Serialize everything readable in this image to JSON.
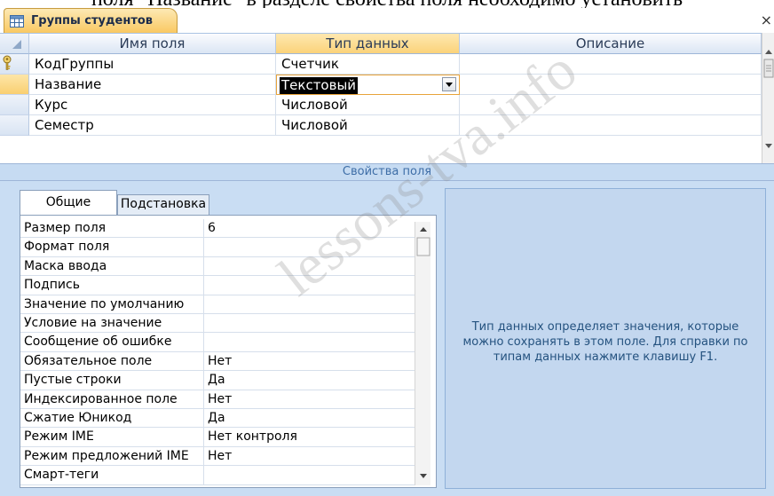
{
  "caption_text": "поля \"Название\" в разделе свойства поля необходимо установить",
  "tab": {
    "title": "Группы студентов",
    "icon": "table-icon"
  },
  "close_glyph": "×",
  "design_grid": {
    "columns": [
      "Имя поля",
      "Тип данных",
      "Описание"
    ],
    "rows": [
      {
        "name": "КодГруппы",
        "type": "Счетчик",
        "description": "",
        "primary_key": true,
        "current": false
      },
      {
        "name": "Название",
        "type": "Текстовый",
        "description": "",
        "primary_key": false,
        "current": true
      },
      {
        "name": "Курс",
        "type": "Числовой",
        "description": "",
        "primary_key": false,
        "current": false
      },
      {
        "name": "Семестр",
        "type": "Числовой",
        "description": "",
        "primary_key": false,
        "current": false
      }
    ]
  },
  "field_properties": {
    "section_title": "Свойства поля",
    "tabs": [
      "Общие",
      "Подстановка"
    ],
    "active_tab": "Общие",
    "properties": [
      {
        "label": "Размер поля",
        "value": "6"
      },
      {
        "label": "Формат поля",
        "value": ""
      },
      {
        "label": "Маска ввода",
        "value": ""
      },
      {
        "label": "Подпись",
        "value": ""
      },
      {
        "label": "Значение по умолчанию",
        "value": ""
      },
      {
        "label": "Условие на значение",
        "value": ""
      },
      {
        "label": "Сообщение об ошибке",
        "value": ""
      },
      {
        "label": "Обязательное поле",
        "value": "Нет"
      },
      {
        "label": "Пустые строки",
        "value": "Да"
      },
      {
        "label": "Индексированное поле",
        "value": "Нет"
      },
      {
        "label": "Сжатие Юникод",
        "value": "Да"
      },
      {
        "label": "Режим IME",
        "value": "Нет контроля"
      },
      {
        "label": "Режим предложений IME",
        "value": "Нет"
      },
      {
        "label": "Смарт-теги",
        "value": ""
      }
    ],
    "help_text": "Тип данных определяет значения, которые можно сохранять в этом поле.  Для справки по типам данных нажмите клавишу F1."
  },
  "watermark": "lessons-tva.info",
  "colors": {
    "tab_gold": "#f9c862",
    "header_blue": "#dbe6f4",
    "pane_blue": "#c9ddf3",
    "help_text": "#24527f",
    "selected_value_bg": "#000000"
  }
}
